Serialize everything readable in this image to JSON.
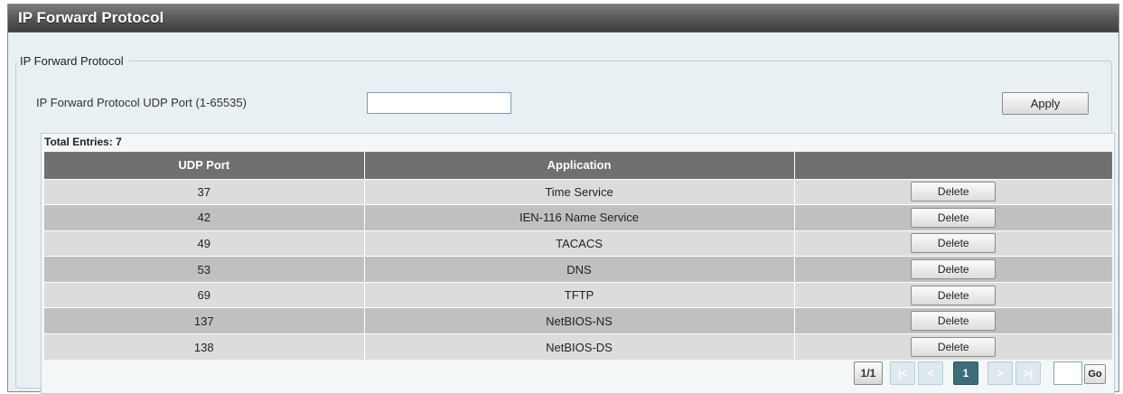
{
  "window": {
    "title": "IP Forward Protocol"
  },
  "section": {
    "legend": "IP Forward Protocol"
  },
  "form": {
    "port_label": "IP Forward Protocol UDP Port (1-65535)",
    "port_value": "",
    "apply_label": "Apply"
  },
  "table": {
    "total_entries_label": "Total Entries: 7",
    "headers": [
      "UDP Port",
      "Application",
      ""
    ],
    "rows": [
      {
        "port": "37",
        "application": "Time Service",
        "action": "Delete"
      },
      {
        "port": "42",
        "application": "IEN-116 Name Service",
        "action": "Delete"
      },
      {
        "port": "49",
        "application": "TACACS",
        "action": "Delete"
      },
      {
        "port": "53",
        "application": "DNS",
        "action": "Delete"
      },
      {
        "port": "69",
        "application": "TFTP",
        "action": "Delete"
      },
      {
        "port": "137",
        "application": "NetBIOS-NS",
        "action": "Delete"
      },
      {
        "port": "138",
        "application": "NetBIOS-DS",
        "action": "Delete"
      }
    ]
  },
  "pagination": {
    "page_info": "1/1",
    "first": "|<",
    "prev": "<",
    "current_page": "1",
    "next": ">",
    "last": ">|",
    "goto_value": "",
    "go_label": "Go"
  },
  "colors": {
    "header_bg": "#707070",
    "row_light": "#dcdcdc",
    "row_dark": "#c0c0c0",
    "active_page": "#3d6d7a"
  }
}
